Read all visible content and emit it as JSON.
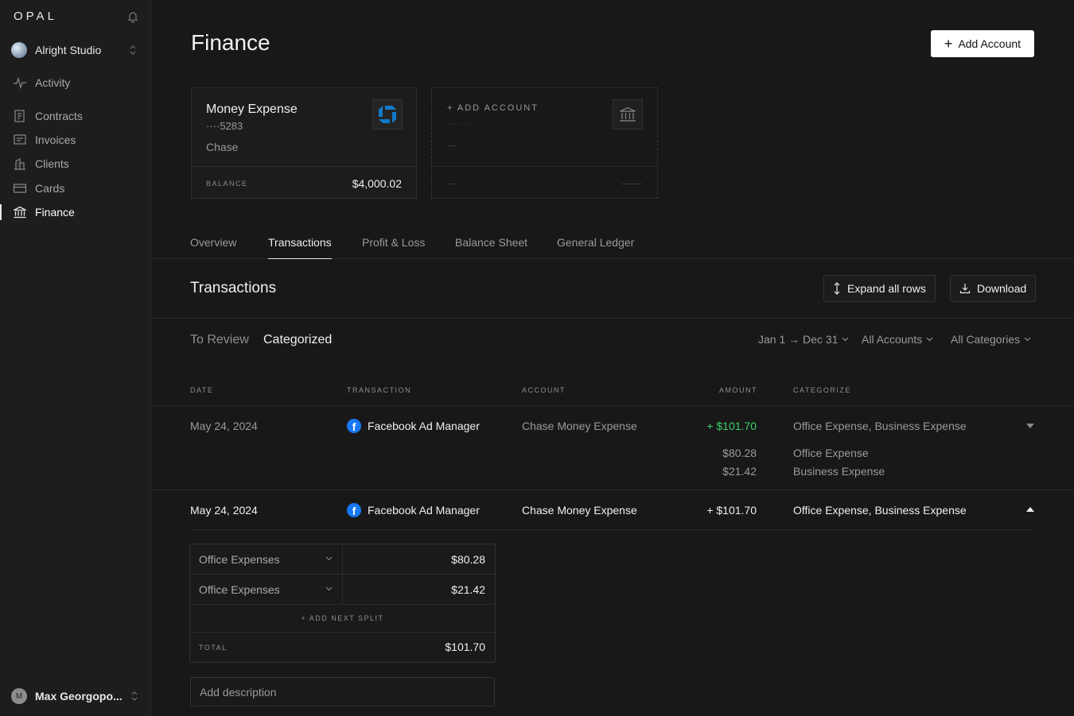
{
  "sidebar": {
    "logo": "OPAL",
    "workspace": "Alright Studio",
    "nav": [
      {
        "label": "Activity",
        "icon": "activity-icon"
      },
      {
        "label": "Contracts",
        "icon": "contract-icon"
      },
      {
        "label": "Invoices",
        "icon": "invoice-icon"
      },
      {
        "label": "Clients",
        "icon": "building-icon"
      },
      {
        "label": "Cards",
        "icon": "card-icon"
      },
      {
        "label": "Finance",
        "icon": "bank-icon"
      }
    ],
    "user": {
      "initial": "M",
      "name": "Max Georgopo..."
    }
  },
  "header": {
    "title": "Finance",
    "add_account_label": "Add Account"
  },
  "account_card": {
    "name": "Money Expense",
    "number": "····5283",
    "bank": "Chase",
    "balance_label": "BALANCE",
    "balance": "$4,000.02"
  },
  "add_card": {
    "label": "+ ADD ACCOUNT",
    "placeholder_dots": "········"
  },
  "tabs": [
    "Overview",
    "Transactions",
    "Profit & Loss",
    "Balance Sheet",
    "General Ledger"
  ],
  "transactions": {
    "title": "Transactions",
    "expand_label": "Expand all rows",
    "download_label": "Download",
    "subtabs": [
      "To Review",
      "Categorized"
    ],
    "filters": {
      "date": "Jan 1 → Dec 31",
      "accounts": "All Accounts",
      "categories": "All Categories"
    },
    "columns": [
      "DATE",
      "TRANSACTION",
      "ACCOUNT",
      "AMOUNT",
      "CATEGORIZE"
    ],
    "rows": [
      {
        "date": "May 24, 2024",
        "transaction": "Facebook Ad Manager",
        "account": "Chase Money Expense",
        "amount": "+ $101.70",
        "category": "Office Expense, Business Expense",
        "splits": [
          {
            "amount": "$80.28",
            "category": "Office Expense"
          },
          {
            "amount": "$21.42",
            "category": "Business Expense"
          }
        ]
      },
      {
        "date": "May 24, 2024",
        "transaction": "Facebook Ad Manager",
        "account": "Chase Money Expense",
        "amount": "+ $101.70",
        "category": "Office Expense, Business Expense"
      }
    ],
    "split_editor": {
      "rows": [
        {
          "category": "Office Expenses",
          "amount": "$80.28"
        },
        {
          "category": "Office Expenses",
          "amount": "$21.42"
        }
      ],
      "add_label": "+  ADD NEXT SPLIT",
      "total_label": "TOTAL",
      "total": "$101.70",
      "description_placeholder": "Add description"
    }
  },
  "colors": {
    "background": "#181818",
    "sidebar": "#1d1d1d",
    "positive": "#3ecf6b",
    "chase_blue": "#117aca",
    "facebook_blue": "#1877f2"
  }
}
